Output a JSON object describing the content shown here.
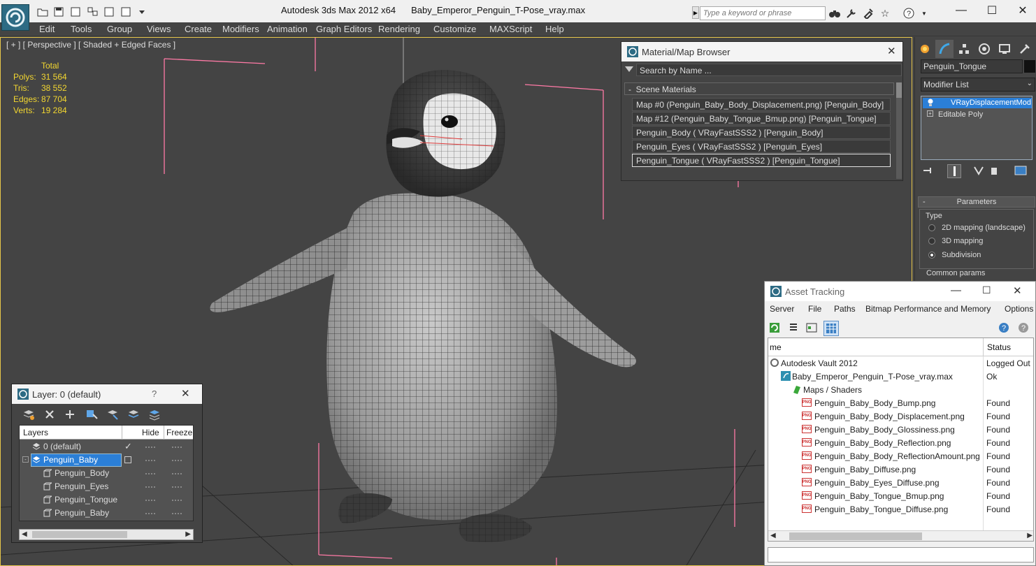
{
  "window": {
    "app_title": "Autodesk 3ds Max  2012 x64",
    "file_title": "Baby_Emperor_Penguin_T-Pose_vray.max",
    "search_placeholder": "Type a keyword or phrase"
  },
  "menu": [
    "Edit",
    "Tools",
    "Group",
    "Views",
    "Create",
    "Modifiers",
    "Animation",
    "Graph Editors",
    "Rendering",
    "Customize",
    "MAXScript",
    "Help"
  ],
  "viewport": {
    "label": "[ + ] [ Perspective ] [ Shaded + Edged Faces ]",
    "stats": {
      "header": "Total",
      "rows": [
        {
          "label": "Polys:",
          "value": "31 564"
        },
        {
          "label": "Tris:",
          "value": "38 552"
        },
        {
          "label": "Edges:",
          "value": "87 704"
        },
        {
          "label": "Verts:",
          "value": "19 284"
        }
      ]
    }
  },
  "material_browser": {
    "title": "Material/Map Browser",
    "search_placeholder": "Search by Name ...",
    "section": "Scene Materials",
    "items": [
      "Map #0 (Penguin_Baby_Body_Displacement.png) [Penguin_Body]",
      "Map #12 (Penguin_Baby_Tongue_Bmup.png) [Penguin_Tongue]",
      "Penguin_Body  ( VRayFastSSS2 )  [Penguin_Body]",
      "Penguin_Eyes  ( VRayFastSSS2 )  [Penguin_Eyes]",
      "Penguin_Tongue  ( VRayFastSSS2 )  [Penguin_Tongue]"
    ],
    "selected_index": 4
  },
  "command_panel": {
    "object_name": "Penguin_Tongue",
    "modifier_list_label": "Modifier List",
    "stack": [
      "VRayDisplacementMod",
      "Editable Poly"
    ],
    "parameters_title": "Parameters",
    "type_label": "Type",
    "radio_options": [
      "2D mapping (landscape)",
      "3D mapping",
      "Subdivision"
    ],
    "radio_selected": 2,
    "common_params_label": "Common params"
  },
  "layer_window": {
    "title": "Layer: 0 (default)",
    "help": "?",
    "columns": [
      "Layers",
      "Hide",
      "Freeze"
    ],
    "rows": [
      {
        "name": "0 (default)",
        "indent": 1,
        "checked": true
      },
      {
        "name": "Penguin_Baby",
        "indent": 0,
        "selected": true
      },
      {
        "name": "Penguin_Body",
        "indent": 2
      },
      {
        "name": "Penguin_Eyes",
        "indent": 2
      },
      {
        "name": "Penguin_Tongue",
        "indent": 2
      },
      {
        "name": "Penguin_Baby",
        "indent": 2
      }
    ]
  },
  "asset_tracking": {
    "title": "Asset Tracking",
    "menu": [
      "Server",
      "File",
      "Paths",
      "Bitmap Performance and Memory",
      "Options"
    ],
    "columns": [
      "me",
      "Status"
    ],
    "rows": [
      {
        "name": "Autodesk Vault 2012",
        "status": "Logged Out",
        "level": 0,
        "icon": "vault-icon"
      },
      {
        "name": "Baby_Emperor_Penguin_T-Pose_vray.max",
        "status": "Ok",
        "level": 1,
        "icon": "max-file-icon"
      },
      {
        "name": "Maps / Shaders",
        "status": "",
        "level": 2,
        "icon": "maps-folder-icon"
      },
      {
        "name": "Penguin_Baby_Body_Bump.png",
        "status": "Found",
        "level": 3,
        "icon": "png-icon"
      },
      {
        "name": "Penguin_Baby_Body_Displacement.png",
        "status": "Found",
        "level": 3,
        "icon": "png-icon"
      },
      {
        "name": "Penguin_Baby_Body_Glossiness.png",
        "status": "Found",
        "level": 3,
        "icon": "png-icon"
      },
      {
        "name": "Penguin_Baby_Body_Reflection.png",
        "status": "Found",
        "level": 3,
        "icon": "png-icon"
      },
      {
        "name": "Penguin_Baby_Body_ReflectionAmount.png",
        "status": "Found",
        "level": 3,
        "icon": "png-icon"
      },
      {
        "name": "Penguin_Baby_Diffuse.png",
        "status": "Found",
        "level": 3,
        "icon": "png-icon"
      },
      {
        "name": "Penguin_Baby_Eyes_Diffuse.png",
        "status": "Found",
        "level": 3,
        "icon": "png-icon"
      },
      {
        "name": "Penguin_Baby_Tongue_Bmup.png",
        "status": "Found",
        "level": 3,
        "icon": "png-icon"
      },
      {
        "name": "Penguin_Baby_Tongue_Diffuse.png",
        "status": "Found",
        "level": 3,
        "icon": "png-icon"
      }
    ]
  },
  "colors": {
    "viewport_bg": "#444444",
    "stats_yellow": "#f2d630",
    "selection_blue": "#2b7fd7",
    "bbox_pink": "#ff7aa6"
  }
}
